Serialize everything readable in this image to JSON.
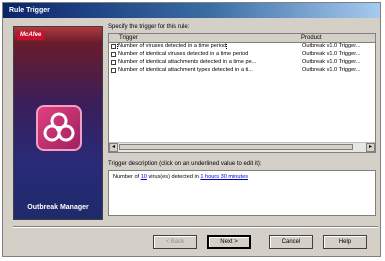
{
  "window": {
    "title": "Rule Trigger"
  },
  "banner": {
    "brand": "McAfee",
    "product": "Outbreak Manager"
  },
  "triggers": {
    "label": "Specify the trigger for this rule:",
    "columns": [
      "Trigger",
      "Product"
    ],
    "rows": [
      {
        "trigger": "Number of viruses detected in a time period",
        "product": "Outbreak v1.0 Trigger..."
      },
      {
        "trigger": "Number of identical viruses detected in a time period",
        "product": "Outbreak v1.0 Trigger..."
      },
      {
        "trigger": "Number of identical attachments detected in a time pe...",
        "product": "Outbreak v1.0 Trigger..."
      },
      {
        "trigger": "Number of identical attachment types detected in a ti...",
        "product": "Outbreak v1.0 Trigger..."
      }
    ]
  },
  "description": {
    "label": "Trigger description (click on an underlined value to edit it):",
    "prefix": "Number of",
    "count": "10",
    "middle": "virus(es) detected in",
    "period": "1 hours 30 minutes"
  },
  "buttons": {
    "back": "< Back",
    "next": "Next >",
    "cancel": "Cancel",
    "help": "Help"
  }
}
